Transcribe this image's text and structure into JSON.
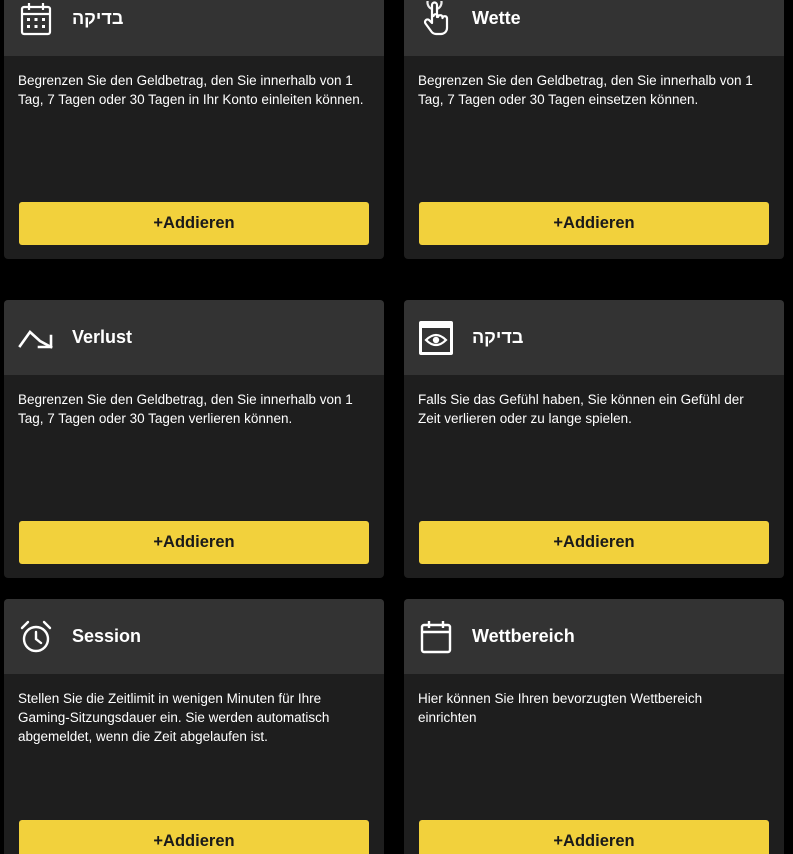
{
  "cards": [
    {
      "title": "בדיקה",
      "icon": "calendar-grid-icon",
      "description": "Begrenzen Sie den Geldbetrag, den Sie innerhalb von 1 Tag, 7 Tagen oder 30 Tagen in Ihr Konto einleiten können.",
      "button_label": "+Addieren"
    },
    {
      "title": "Wette",
      "icon": "hand-pointer-icon",
      "description": "Begrenzen Sie den Geldbetrag, den Sie innerhalb von 1 Tag, 7 Tagen oder 30 Tagen einsetzen können.",
      "button_label": "+Addieren"
    },
    {
      "title": "Verlust",
      "icon": "trend-down-icon",
      "description": "Begrenzen Sie den Geldbetrag, den Sie innerhalb von 1 Tag, 7 Tagen oder 30 Tagen verlieren können.",
      "button_label": "+Addieren"
    },
    {
      "title": "בדיקה",
      "icon": "eye-icon",
      "description": "Falls Sie das Gefühl haben, Sie können ein Gefühl der Zeit verlieren oder zu lange spielen.",
      "button_label": "+Addieren"
    },
    {
      "title": "Session",
      "icon": "alarm-clock-icon",
      "description": "Stellen Sie die Zeitlimit in wenigen Minuten für Ihre Gaming-Sitzungsdauer ein. Sie werden automatisch abgemeldet, wenn die Zeit abgelaufen ist.",
      "button_label": "+Addieren"
    },
    {
      "title": "Wettbereich",
      "icon": "calendar-icon",
      "description": "Hier können Sie Ihren bevorzugten Wettbereich einrichten",
      "button_label": "+Addieren"
    }
  ],
  "colors": {
    "page_background": "#000000",
    "card_background": "#1e1e1e",
    "card_header": "#333333",
    "accent_button": "#f2d13c"
  }
}
